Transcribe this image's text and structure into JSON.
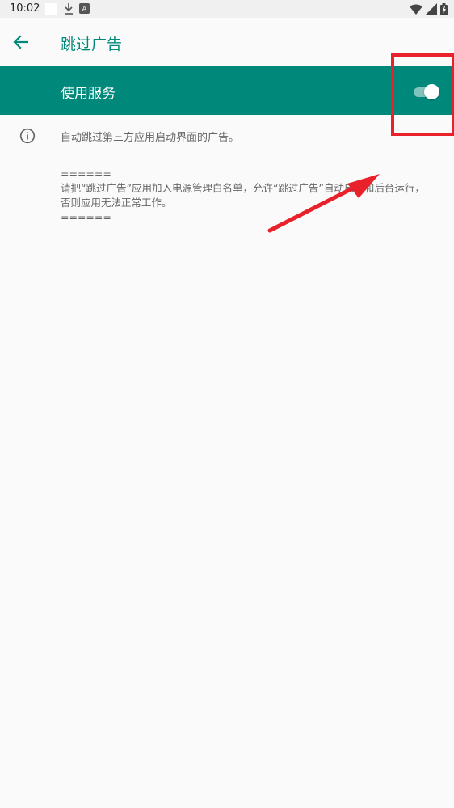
{
  "status_bar": {
    "time": "10:02",
    "a_icon_glyph": "A"
  },
  "toolbar": {
    "title": "跳过广告"
  },
  "master_switch": {
    "label": "使用服务",
    "enabled": true
  },
  "info": {
    "text": "自动跳过第三方应用启动界面的广告。"
  },
  "note": {
    "separator_top": "======",
    "line1": "请把“跳过广告”应用加入电源管理白名单，允许“跳过广告”自动启动和后台运行，",
    "line2": "否则应用无法正常工作。",
    "separator_bottom": "======"
  },
  "colors": {
    "accent": "#00897b",
    "highlight": "#e8212b"
  },
  "icons": {
    "back": "arrow-left-icon",
    "info": "info-circle-icon",
    "wifi": "wifi-icon",
    "signal": "cell-signal-icon",
    "battery": "battery-icon",
    "download": "download-icon"
  }
}
